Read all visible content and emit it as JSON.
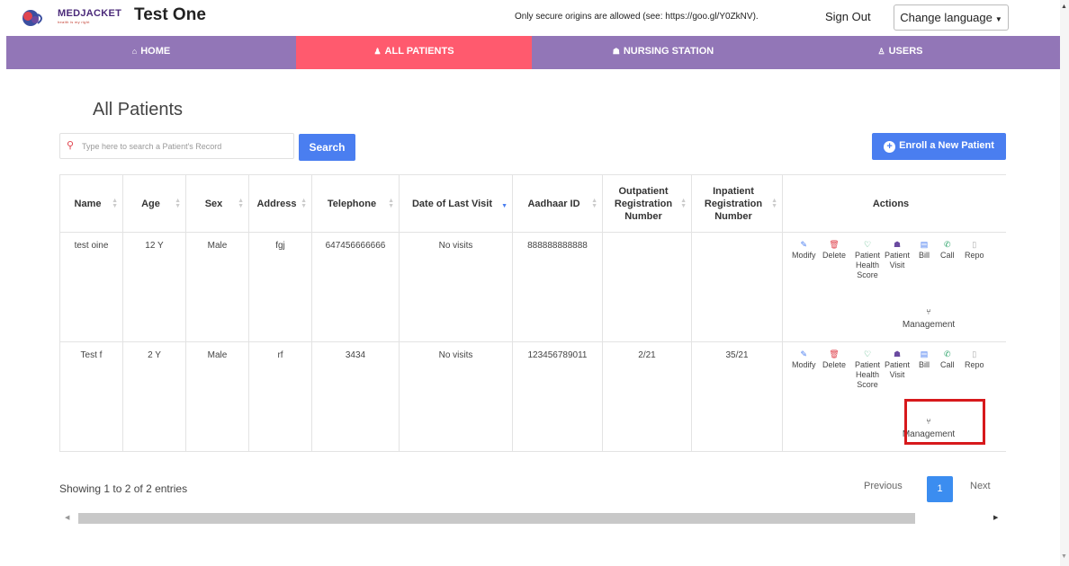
{
  "header": {
    "brand_name": "MEDJACKET",
    "brand_tagline": "health is my right",
    "app_title": "Test One",
    "notice": "Only secure origins are allowed (see: https://goo.gl/Y0ZkNV).",
    "sign_out": "Sign Out",
    "language_button": "Change language"
  },
  "nav": {
    "items": [
      {
        "label": "HOME",
        "icon": "home-icon"
      },
      {
        "label": "ALL PATIENTS",
        "icon": "patient-icon",
        "active": true
      },
      {
        "label": "NURSING STATION",
        "icon": "group-icon"
      },
      {
        "label": "USERS",
        "icon": "user-icon"
      }
    ]
  },
  "main": {
    "title": "All Patients",
    "search_placeholder": "Type here to search a Patient's Record",
    "search_button": "Search",
    "enroll_button": "Enroll a New Patient"
  },
  "table": {
    "columns": [
      "Name",
      "Age",
      "Sex",
      "Address",
      "Telephone",
      "Date of Last Visit",
      "Aadhaar ID",
      "Outpatient Registration Number",
      "Inpatient Registration Number",
      "Actions"
    ],
    "rows": [
      {
        "name": "test oine",
        "age": "12 Y",
        "sex": "Male",
        "address": "fgj",
        "telephone": "647456666666",
        "last_visit": "No visits",
        "aadhaar": "888888888888",
        "outpatient": "",
        "inpatient": ""
      },
      {
        "name": "Test f",
        "age": "2 Y",
        "sex": "Male",
        "address": "rf",
        "telephone": "3434",
        "last_visit": "No visits",
        "aadhaar": "123456789011",
        "outpatient": "2/21",
        "inpatient": "35/21"
      }
    ],
    "actions": {
      "modify": "Modify",
      "delete": "Delete",
      "health_score": "Patient Health Score",
      "patient_visit": "Patient Visit",
      "bill": "Bill",
      "call": "Call",
      "report": "Repo",
      "management": "Management"
    }
  },
  "footer": {
    "entries": "Showing 1 to 2 of 2 entries",
    "previous": "Previous",
    "page": "1",
    "next": "Next"
  },
  "colors": {
    "nav_bg": "#9276b7",
    "nav_active": "#ff5a6e",
    "primary_button": "#4a7ef0",
    "highlight": "#d7191c"
  }
}
